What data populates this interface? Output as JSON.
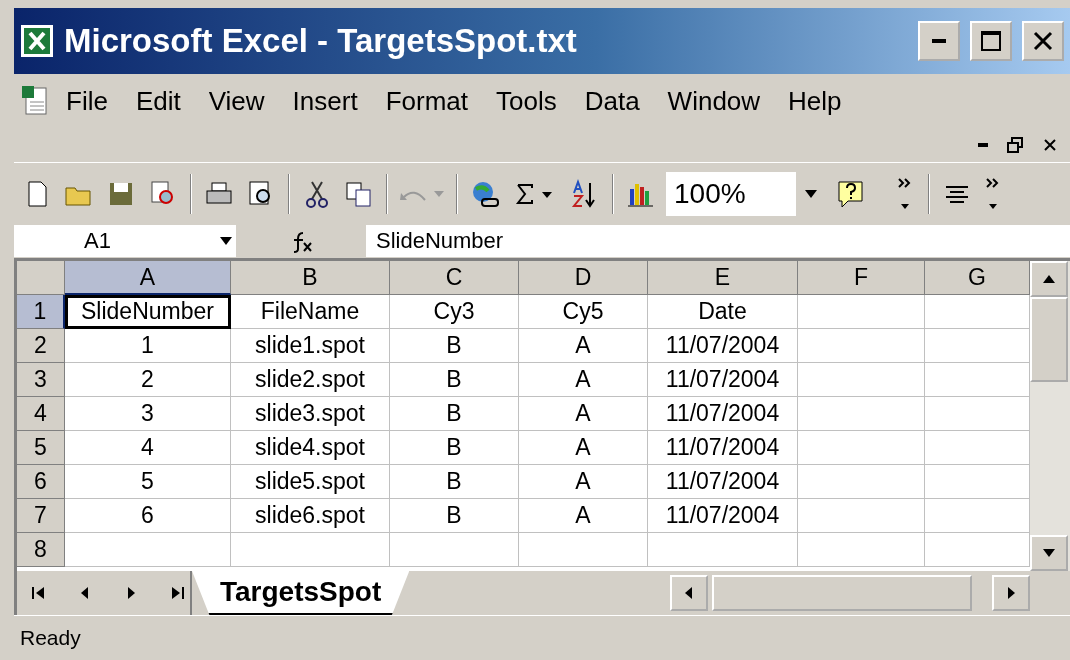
{
  "window": {
    "title": "Microsoft Excel - TargetsSpot.txt"
  },
  "menu": [
    "File",
    "Edit",
    "View",
    "Insert",
    "Format",
    "Tools",
    "Data",
    "Window",
    "Help"
  ],
  "toolbar": {
    "zoom": "100%"
  },
  "formula_bar": {
    "name_box": "A1",
    "formula": "SlideNumber"
  },
  "sheet": {
    "columns": [
      {
        "label": "A",
        "selected": true
      },
      {
        "label": "B",
        "selected": false
      },
      {
        "label": "C",
        "selected": false
      },
      {
        "label": "D",
        "selected": false
      },
      {
        "label": "E",
        "selected": false
      },
      {
        "label": "F",
        "selected": false
      },
      {
        "label": "G",
        "selected": false
      }
    ],
    "rows": [
      {
        "number": "1",
        "selected": true,
        "cells": [
          "SlideNumber",
          "FileName",
          "Cy3",
          "Cy5",
          "Date"
        ]
      },
      {
        "number": "2",
        "selected": false,
        "cells": [
          "1",
          "slide1.spot",
          "B",
          "A",
          "11/07/2004"
        ]
      },
      {
        "number": "3",
        "selected": false,
        "cells": [
          "2",
          "slide2.spot",
          "B",
          "A",
          "11/07/2004"
        ]
      },
      {
        "number": "4",
        "selected": false,
        "cells": [
          "3",
          "slide3.spot",
          "B",
          "A",
          "11/07/2004"
        ]
      },
      {
        "number": "5",
        "selected": false,
        "cells": [
          "4",
          "slide4.spot",
          "B",
          "A",
          "11/07/2004"
        ]
      },
      {
        "number": "6",
        "selected": false,
        "cells": [
          "5",
          "slide5.spot",
          "B",
          "A",
          "11/07/2004"
        ]
      },
      {
        "number": "7",
        "selected": false,
        "cells": [
          "6",
          "slide6.spot",
          "B",
          "A",
          "11/07/2004"
        ]
      },
      {
        "number": "8",
        "selected": false
      }
    ]
  },
  "sheet_tabs": [
    {
      "label": "TargetsSpot",
      "selected": true
    }
  ],
  "status_bar": {
    "text": "Ready"
  }
}
